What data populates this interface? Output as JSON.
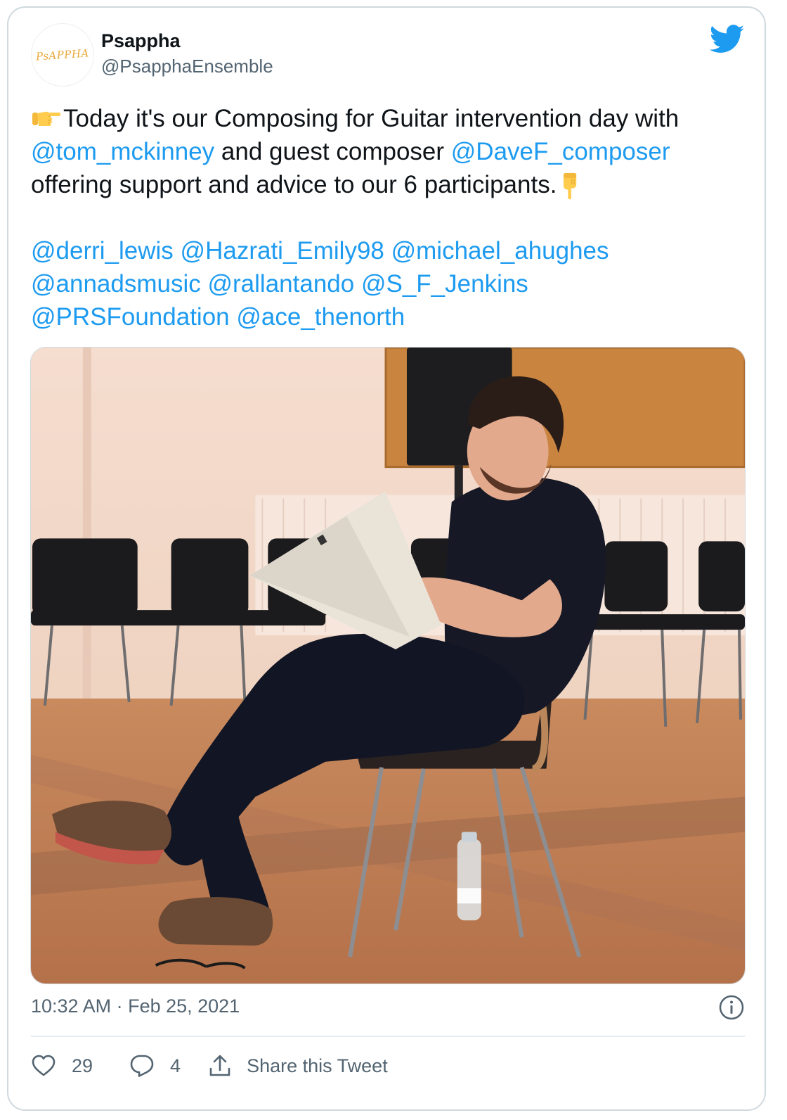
{
  "author": {
    "display_name": "Psappha",
    "handle": "@PsapphaEnsemble",
    "avatar_text": "PsAPPHA"
  },
  "tweet": {
    "line1_text": "Today it's our Composing for Guitar intervention day with",
    "line2_mention1": "@tom_mckinney",
    "line2_text": " and guest composer ",
    "line2_mention2": "@DaveF_composer",
    "line3_text": "offering support and advice to our 6 participants.",
    "mentions": [
      [
        "@derri_lewis",
        "@Hazrati_Emily98",
        "@michael_ahughes"
      ],
      [
        "@annadsmusic",
        "@rallantando",
        "@S_F_Jenkins"
      ],
      [
        "@PRSFoundation",
        "@ace_thenorth"
      ]
    ]
  },
  "media": {
    "type": "photo",
    "subject": "man reading sheet music seated on chair"
  },
  "meta": {
    "timestamp": "10:32 AM · Feb 25, 2021"
  },
  "actions": {
    "like_count": "29",
    "reply_count": "4",
    "share_label": "Share this Tweet"
  },
  "colors": {
    "mention": "#1d9bf0",
    "text": "#0f1419",
    "secondary": "#536471",
    "twitter_blue": "#1d9bf0"
  },
  "icons": [
    "twitter-bird-icon",
    "pointing-right-emoji",
    "pointing-down-emoji",
    "info-icon",
    "heart-icon",
    "reply-icon",
    "share-icon"
  ]
}
